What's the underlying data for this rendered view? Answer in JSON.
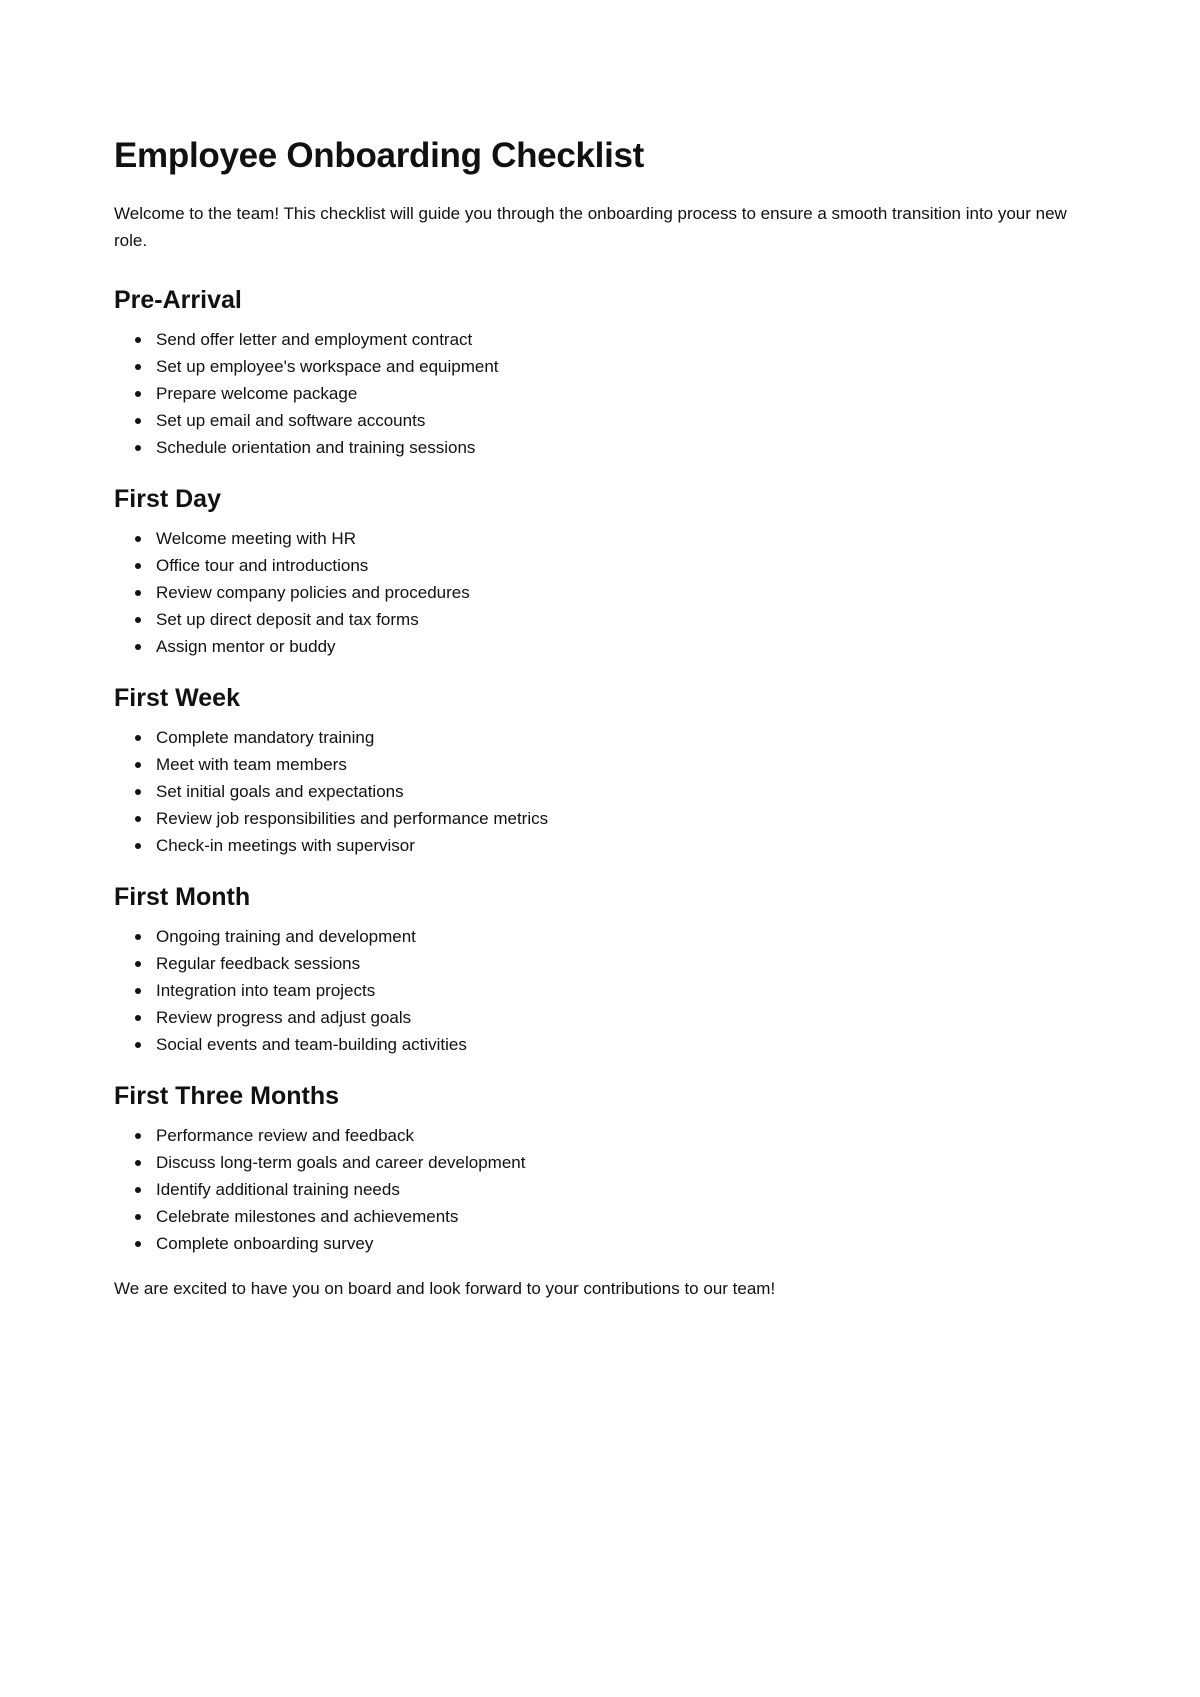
{
  "document": {
    "title": "Employee Onboarding Checklist",
    "intro": "Welcome to the team! This checklist will guide you through the onboarding process to ensure a smooth transition into your new role.",
    "sections": [
      {
        "heading": "Pre-Arrival",
        "items": [
          "Send offer letter and employment contract",
          "Set up employee's workspace and equipment",
          "Prepare welcome package",
          "Set up email and software accounts",
          "Schedule orientation and training sessions"
        ]
      },
      {
        "heading": "First Day",
        "items": [
          "Welcome meeting with HR",
          "Office tour and introductions",
          "Review company policies and procedures",
          "Set up direct deposit and tax forms",
          "Assign mentor or buddy"
        ]
      },
      {
        "heading": "First Week",
        "items": [
          "Complete mandatory training",
          "Meet with team members",
          "Set initial goals and expectations",
          "Review job responsibilities and performance metrics",
          "Check-in meetings with supervisor"
        ]
      },
      {
        "heading": "First Month",
        "items": [
          "Ongoing training and development",
          "Regular feedback sessions",
          "Integration into team projects",
          "Review progress and adjust goals",
          "Social events and team-building activities"
        ]
      },
      {
        "heading": "First Three Months",
        "items": [
          "Performance review and feedback",
          "Discuss long-term goals and career development",
          "Identify additional training needs",
          "Celebrate milestones and achievements",
          "Complete onboarding survey"
        ]
      }
    ],
    "closing": "We are excited to have you on board and look forward to your contributions to our team!"
  }
}
